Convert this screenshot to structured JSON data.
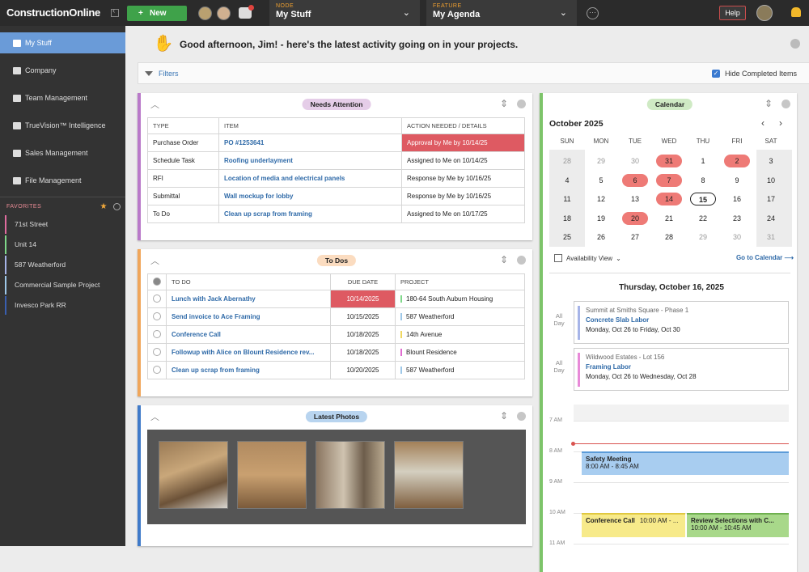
{
  "top": {
    "logo": "ConstructionOnline",
    "new_label": "New",
    "node_cap": "NODE",
    "node_val": "My Stuff",
    "feature_cap": "FEATURE",
    "feature_val": "My Agenda",
    "help": "Help"
  },
  "sidebar": {
    "items": [
      {
        "label": "My Stuff",
        "icon": "stack-icon"
      },
      {
        "label": "Company",
        "icon": "building-icon"
      },
      {
        "label": "Team Management",
        "icon": "person-icon"
      },
      {
        "label": "TrueVision™ Intelligence",
        "icon": "analytics-icon"
      },
      {
        "label": "Sales Management",
        "icon": "database-icon"
      },
      {
        "label": "File Management",
        "icon": "folder-icon"
      }
    ],
    "fav_title": "FAVORITES",
    "favorites": [
      {
        "label": "71st Street",
        "color": "#e06c9f"
      },
      {
        "label": "Unit 14",
        "color": "#7fd88a"
      },
      {
        "label": "587 Weatherford",
        "color": "#a6b4e8"
      },
      {
        "label": "Commercial Sample Project",
        "color": "#9ec8e8"
      },
      {
        "label": "Invesco Park RR",
        "color": "#3a5fb0"
      }
    ]
  },
  "greeting": "Good afternoon, Jim! - here's the latest activity going on in your projects.",
  "filters": {
    "label": "Filters",
    "hide": "Hide Completed Items"
  },
  "needs": {
    "title": "Needs Attention",
    "headers": [
      "TYPE",
      "ITEM",
      "ACTION NEEDED / DETAILS"
    ],
    "rows": [
      [
        "Purchase Order",
        "PO #1253641",
        "Approval by Me by 10/14/25"
      ],
      [
        "Schedule Task",
        "Roofing underlayment",
        "Assigned to Me on 10/14/25"
      ],
      [
        "RFI",
        "Location of media and electrical panels",
        "Response by Me by 10/16/25"
      ],
      [
        "Submittal",
        "Wall mockup for lobby",
        "Response by Me by 10/16/25"
      ],
      [
        "To Do",
        "Clean up scrap from framing",
        "Assigned to Me on 10/17/25"
      ]
    ]
  },
  "todos": {
    "title": "To Dos",
    "headers": [
      "TO DO",
      "DUE DATE",
      "PROJECT"
    ],
    "rows": [
      [
        "Lunch with Jack Abernathy",
        "10/14/2025",
        "180-64 South Auburn Housing"
      ],
      [
        "Send invoice to Ace Framing",
        "10/15/2025",
        "587 Weatherford"
      ],
      [
        "Conference Call",
        "10/18/2025",
        "14th Avenue"
      ],
      [
        "Followup with Alice on Blount Residence rev...",
        "10/18/2025",
        "Blount Residence"
      ],
      [
        "Clean up scrap from framing",
        "10/20/2025",
        "587 Weatherford"
      ]
    ],
    "proj_colors": [
      "#7fd88a",
      "#9ec8e8",
      "#f0d860",
      "#e06cd0",
      "#9ec8e8"
    ]
  },
  "photos": {
    "title": "Latest Photos"
  },
  "calendar": {
    "title": "Calendar",
    "month": "October 2025",
    "dow": [
      "SUN",
      "MON",
      "TUE",
      "WED",
      "THU",
      "FRI",
      "SAT"
    ],
    "weeks": [
      [
        "28",
        "29",
        "30",
        "31",
        "1",
        "2",
        "3"
      ],
      [
        "4",
        "5",
        "6",
        "7",
        "8",
        "9",
        "10"
      ],
      [
        "11",
        "12",
        "13",
        "14",
        "15",
        "16",
        "17"
      ],
      [
        "18",
        "19",
        "20",
        "21",
        "22",
        "23",
        "24"
      ],
      [
        "25",
        "26",
        "27",
        "28",
        "29",
        "30",
        "31"
      ]
    ],
    "avail": "Availability View",
    "goto": "Go to Calendar",
    "day_title": "Thursday, October 16, 2025",
    "allday": "All Day",
    "events": [
      {
        "loc": "Summit at Smiths Square - Phase 1",
        "name": "Concrete Slab Labor",
        "dates": "Monday, Oct 26 to Friday, Oct 30",
        "color": "#a6b4e8"
      },
      {
        "loc": "Wildwood Estates - Lot 156",
        "name": "Framing Labor",
        "dates": "Monday, Oct 26 to Wednesday, Oct 28",
        "color": "#e88ad8"
      }
    ],
    "hours": [
      "7 AM",
      "8 AM",
      "9 AM",
      "10 AM",
      "11 AM"
    ],
    "meetings": [
      {
        "name": "Safety Meeting",
        "time": "8:00 AM - 8:45 AM"
      },
      {
        "name": "Conference Call",
        "time": "10:00 AM - ..."
      },
      {
        "name": "Review Selections with C...",
        "time": "10:00 AM - 10:45 AM"
      }
    ]
  }
}
